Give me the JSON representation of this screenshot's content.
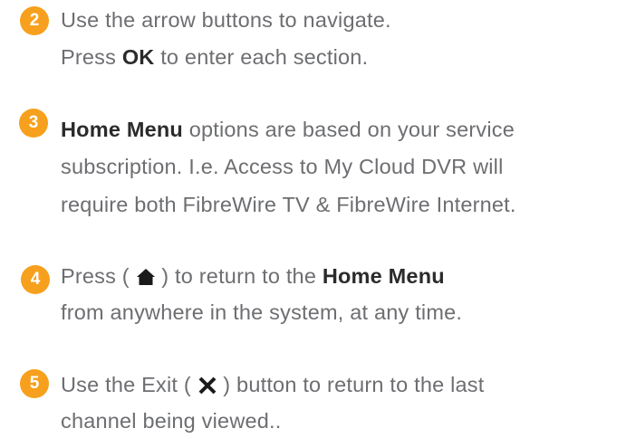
{
  "colors": {
    "badge": "#f7a01d",
    "text": "#6d6e71",
    "emphasis": "#2b2b2b"
  },
  "steps": [
    {
      "number": "2",
      "line1": "Use the arrow buttons to navigate.",
      "line2_pre": "Press ",
      "line2_bold": "OK",
      "line2_post": " to enter each section."
    },
    {
      "number": "3",
      "line1_bold": "Home Menu",
      "line1_post": " options are based on your service",
      "line2": "subscription. I.e. Access to My Cloud DVR will",
      "line3": "require both FibreWire TV & FibreWire Internet."
    },
    {
      "number": "4",
      "line1_pre": "Press ( ",
      "line1_icon": "home-icon",
      "line1_mid": " ) to return to the ",
      "line1_bold": "Home Menu",
      "line2": "from anywhere in the system, at any time."
    },
    {
      "number": "5",
      "line1_pre": "Use the Exit ( ",
      "line1_icon": "close-x-icon",
      "line1_post": " ) button to return to the last",
      "line2": "channel being viewed.."
    }
  ]
}
